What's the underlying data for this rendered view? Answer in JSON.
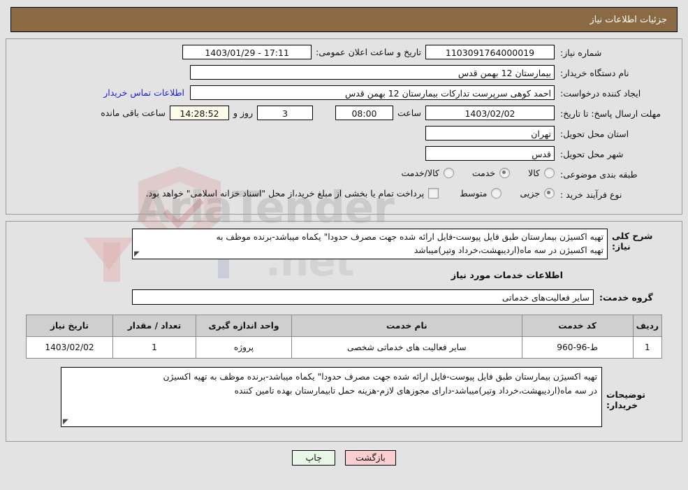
{
  "header": {
    "title": "جزئیات اطلاعات نیاز"
  },
  "form": {
    "need_number_label": "شماره نیاز:",
    "need_number_value": "1103091764000019",
    "public_announce_label": "تاریخ و ساعت اعلان عمومی:",
    "public_announce_value": "17:11 - 1403/01/29",
    "buyer_org_label": "نام دستگاه خریدار:",
    "buyer_org_value": "بیمارستان 12 بهمن قدس",
    "requester_label": "ایجاد کننده درخواست:",
    "requester_value": "احمد کوهی سرپرست تدارکات بیمارستان 12 بهمن قدس",
    "contact_link": "اطلاعات تماس خریدار",
    "deadline_label": "مهلت ارسال پاسخ: تا تاریخ:",
    "deadline_date": "1403/02/02",
    "hour_label": "ساعت",
    "deadline_time": "08:00",
    "days_value": "3",
    "days_label": "روز و",
    "remaining_clock": "14:28:52",
    "remaining_label": "ساعت باقی مانده",
    "province_label": "استان محل تحویل:",
    "province_value": "تهران",
    "city_label": "شهر محل تحویل:",
    "city_value": "قدس",
    "category_label": "طبقه بندی موضوعی:",
    "category_options": [
      {
        "label": "کالا",
        "selected": false
      },
      {
        "label": "خدمت",
        "selected": true
      },
      {
        "label": "کالا/خدمت",
        "selected": false
      }
    ],
    "process_label": "نوع فرآیند خرید :",
    "process_options": [
      {
        "label": "جزیی",
        "selected": true
      },
      {
        "label": "متوسط",
        "selected": false
      }
    ],
    "treasury_checkbox_label": "پرداخت تمام یا بخشی از مبلغ خرید،از محل \"اسناد خزانه اسلامی\" خواهد بود.",
    "treasury_checked": false
  },
  "description": {
    "label": "شرح کلی نیاز:",
    "line1": "تهیه اکسیژن بیمارستان طبق فایل پیوست-فایل ارائه شده جهت مصرف حدودا\" یکماه میباشد-برنده موظف به",
    "line2": "تهیه اکسیژن در سه ماه(اردیبهشت،خرداد وتیر)میباشد"
  },
  "services": {
    "section_title": "اطلاعات خدمات مورد نیاز",
    "group_label": "گروه خدمت:",
    "group_value": "سایر فعالیت‌های خدماتی",
    "table": {
      "columns": [
        "ردیف",
        "کد خدمت",
        "نام خدمت",
        "واحد اندازه گیری",
        "تعداد / مقدار",
        "تاریخ نیاز"
      ],
      "rows": [
        {
          "radif": "1",
          "code": "ط-96-960",
          "name": "سایر فعالیت های خدماتی شخصی",
          "unit": "پروژه",
          "qty": "1",
          "date": "1403/02/02"
        }
      ]
    }
  },
  "buyer_notes": {
    "label": "توضیحات خریدار:",
    "line1": "تهیه اکسیژن بیمارستان طبق فایل پیوست-فایل ارائه شده جهت مصرف حدودا\" یکماه میباشد-برنده موظف به تهیه اکسیژن",
    "line2": "در سه ماه(اردیبهشت،خرداد وتیر)میباشد-دارای مجوزهای لازم-هزینه حمل تابیمارستان بهده تامین کننده"
  },
  "footer": {
    "print_label": "چاپ",
    "back_label": "بازگشت"
  },
  "watermark": {
    "text1": "AriaTender",
    "text2": ".net"
  },
  "colors": {
    "header_bg": "#8a6a42",
    "page_bg": "#e3e3e3",
    "link": "#1a1ae0",
    "print_btn": "#e9f7e9",
    "back_btn": "#fbcfcf",
    "table_header": "#cfcfcf",
    "cream_field": "#fbfbe8"
  }
}
